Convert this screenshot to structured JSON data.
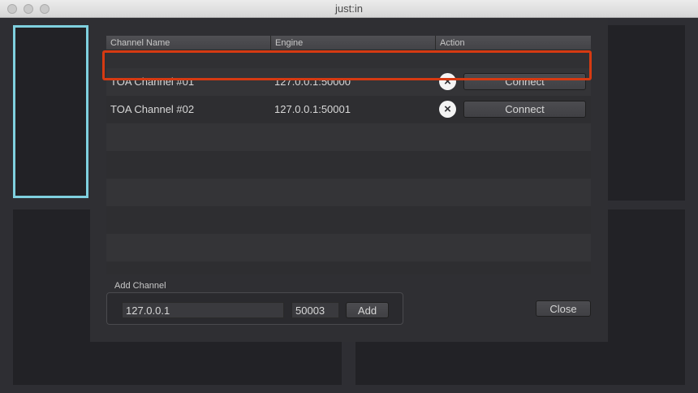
{
  "window": {
    "title": "just:in"
  },
  "table": {
    "columns": [
      "Channel Name",
      "Engine",
      "Action"
    ],
    "rows": [
      {
        "name": "TOA Channel #01",
        "engine": "127.0.0.1:50000",
        "action": "Connect"
      },
      {
        "name": "TOA Channel #02",
        "engine": "127.0.0.1:50001",
        "action": "Connect"
      }
    ]
  },
  "add_channel": {
    "label": "Add Channel",
    "ip": "127.0.0.1",
    "port": "50003",
    "add_label": "Add"
  },
  "close_label": "Close",
  "icons": {
    "remove": "×"
  },
  "colors": {
    "highlight": "#d63a12",
    "selected_pane": "#7fd0df"
  }
}
